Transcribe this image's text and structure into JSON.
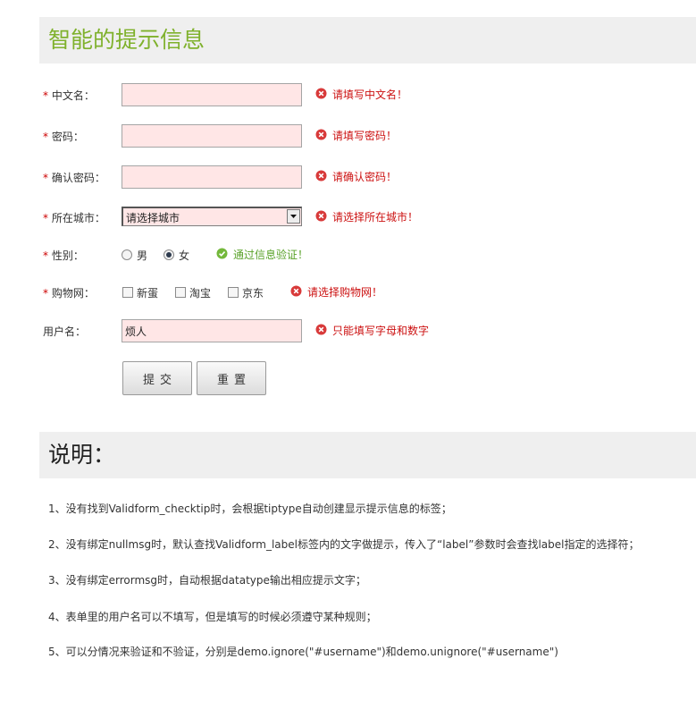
{
  "header": {
    "title": "智能的提示信息"
  },
  "form": {
    "chinese_name": {
      "required": "*",
      "label": "中文名：",
      "value": "",
      "tip": "请填写中文名！"
    },
    "password": {
      "required": "*",
      "label": "密码：",
      "value": "",
      "tip": "请填写密码！"
    },
    "confirm_password": {
      "required": "*",
      "label": "确认密码：",
      "value": "",
      "tip": "请确认密码！"
    },
    "city": {
      "required": "*",
      "label": "所在城市：",
      "selected": "请选择城市",
      "tip": "请选择所在城市！"
    },
    "gender": {
      "required": "*",
      "label": "性别：",
      "options": [
        {
          "label": "男",
          "checked": false
        },
        {
          "label": "女",
          "checked": true
        }
      ],
      "tip": "通过信息验证！"
    },
    "shopping": {
      "required": "*",
      "label": "购物网：",
      "options": [
        {
          "label": "新蛋",
          "checked": false
        },
        {
          "label": "淘宝",
          "checked": false
        },
        {
          "label": "京东",
          "checked": false
        }
      ],
      "tip": "请选择购物网！"
    },
    "username": {
      "label": "用户名：",
      "value": "烦人",
      "tip": "只能填写字母和数字"
    },
    "submit_label": "提交",
    "reset_label": "重置"
  },
  "notes": {
    "title": "说明：",
    "items": [
      "1、没有找到Validform_checktip时，会根据tiptype自动创建显示提示信息的标签；",
      "2、没有绑定nullmsg时，默认查找Validform_label标签内的文字做提示，传入了“label”参数时会查找label指定的选择符；",
      "3、没有绑定errormsg时，自动根据datatype输出相应提示文字；",
      "4、表单里的用户名可以不填写，但是填写的时候必须遵守某种规则；",
      "5、可以分情况来验证和不验证，分别是demo.ignore(\"#username\")和demo.unignore(\"#username\")"
    ]
  },
  "colors": {
    "accent_title": "#7fb12c",
    "error_text": "#cc1111",
    "success_text": "#59a229",
    "input_error_bg": "#ffe6e6"
  }
}
